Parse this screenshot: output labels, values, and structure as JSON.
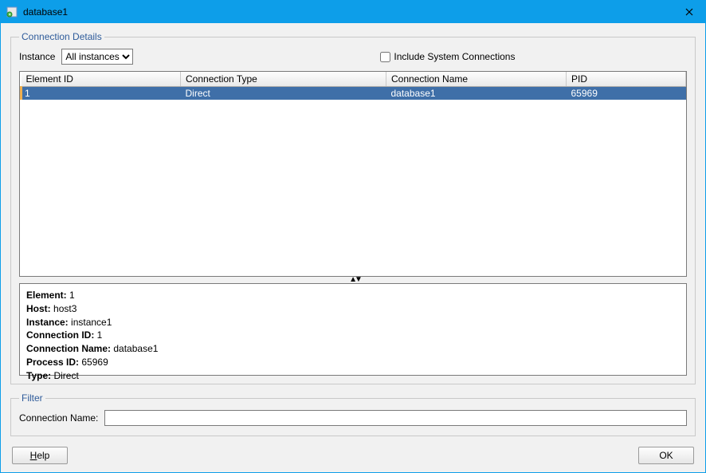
{
  "window": {
    "title": "database1"
  },
  "connectionDetails": {
    "legend": "Connection Details",
    "instanceLabel": "Instance",
    "instanceValue": "All instances",
    "includeSystemLabel": "Include System Connections",
    "columns": {
      "elementId": "Element ID",
      "connectionType": "Connection Type",
      "connectionName": "Connection Name",
      "pid": "PID"
    },
    "rows": [
      {
        "elementId": "1",
        "connectionType": "Direct",
        "connectionName": "database1",
        "pid": "65969"
      }
    ],
    "details": {
      "elementLabel": "Element:",
      "elementValue": "1",
      "hostLabel": "Host:",
      "hostValue": "host3",
      "instanceLabel": "Instance:",
      "instanceValue": "instance1",
      "connectionIdLabel": "Connection ID:",
      "connectionIdValue": "1",
      "connectionNameLabel": "Connection Name:",
      "connectionNameValue": "database1",
      "processIdLabel": "Process ID:",
      "processIdValue": "65969",
      "typeLabel": "Type:",
      "typeValue": "Direct"
    }
  },
  "filter": {
    "legend": "Filter",
    "connectionNameLabel": "Connection Name:",
    "connectionNameValue": ""
  },
  "buttons": {
    "help": "Help",
    "ok": "OK"
  }
}
